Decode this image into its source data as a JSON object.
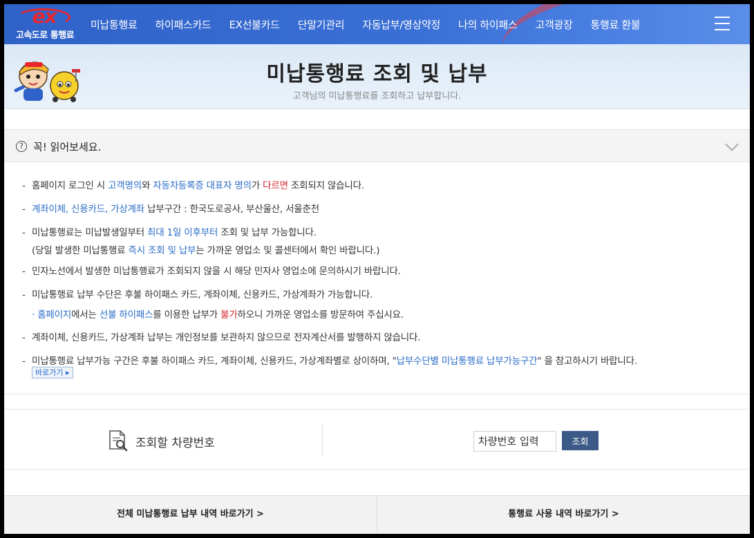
{
  "header": {
    "logo_mark": "ex",
    "logo_text": "고속도로 통행료",
    "menu": [
      "미납통행료",
      "하이패스카드",
      "EX선불카드",
      "단말기관리",
      "자동납부/영상약정",
      "나의 하이패스",
      "고객광장",
      "통행료 환불"
    ]
  },
  "banner": {
    "title": "미납통행료 조회 및 납부",
    "subtitle": "고객님의 미납통행료를 조회하고 납부합니다."
  },
  "notice": {
    "icon_label": "?",
    "title": "꼭! 읽어보세요.",
    "items": {
      "i1": {
        "a": "홈페이지 로그인 시 ",
        "b": "고객명의",
        "c": "와 ",
        "d": "자동차등록증 대표자 명의",
        "e": "가 ",
        "f": "다르면",
        "g": " 조회되지 않습니다."
      },
      "i2": {
        "a": "계좌이체, 신용카드, 가상계좌",
        "b": " 납부구간 : 한국도로공사, 부산울산, 서울춘천"
      },
      "i3": {
        "a": "미납통행료는 미납발생일부터 ",
        "b": "최대 1일 이후부터",
        "c": " 조회 및 납부 가능합니다.",
        "d": "(당일 발생한 미납통행료 ",
        "e": "즉시 조회 및 납부",
        "f": "는 가까운 영업소 및 콜센터에서 확인 바랍니다.)"
      },
      "i4": {
        "a": "민자노선에서 발생한 미납통행료가 조회되지 않을 시 해당 민자사 영업소에 문의하시기 바랍니다."
      },
      "i5": {
        "a": "미납통행료 납부 수단은 후불 하이패스 카드, 계좌이체, 신용카드, 가상계좌가 가능합니다.",
        "bullet": "·",
        "b": "홈페이지",
        "c": "에서는 ",
        "d": "선불 하이패스",
        "e": "를 이용한 납부가 ",
        "f": "불가",
        "g": "하오니 가까운 영업소를 방문하여 주십시요."
      },
      "i6": {
        "a": "계좌이체, 신용카드, 가상계좌 납부는 개인정보를 보관하지 않으므로 전자계산서를 발행하지 않습니다."
      },
      "i7": {
        "a": "미납통행료 납부가능 구간은 후불 하이패스 카드, 계좌이체, 신용카드, 가상계좌별로 상이하며, \"",
        "b": "납부수단별 미납통행료 납부가능구간",
        "c": "\" 을 참고하시기 바랍니다."
      }
    },
    "goto_button": "바로가기 ▸"
  },
  "search": {
    "label": "조회할 차량번호",
    "input_value": "",
    "input_placeholder": "차량번호 입력",
    "button": "조회"
  },
  "bottom_links": [
    "전체 미납통행료 납부 내역 바로가기 >",
    "통행료 사용 내역 바로가기 >"
  ],
  "colors": {
    "nav_blue": "#2f62c8",
    "link_blue": "#2a6cc8",
    "alert_red": "#d9272e",
    "button_navy": "#3c5a87"
  }
}
